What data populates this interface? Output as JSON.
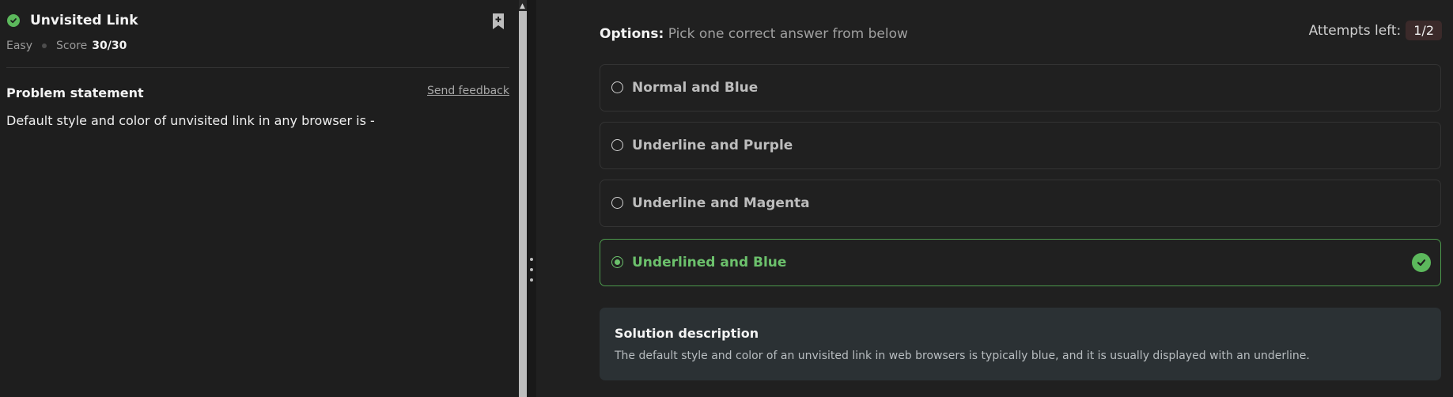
{
  "problem": {
    "title": "Unvisited Link",
    "difficulty": "Easy",
    "score_label": "Score",
    "score_value": "30/30",
    "statement_label": "Problem statement",
    "feedback_link": "Send feedback",
    "statement": "Default style and color of unvisited link in any browser is -"
  },
  "options_panel": {
    "heading_bold": "Options:",
    "heading_rest": "Pick one correct answer from below",
    "attempts_label": "Attempts left:",
    "attempts_value": "1/2",
    "options": [
      {
        "label": "Normal and Blue",
        "selected": false,
        "correct": false
      },
      {
        "label": "Underline and Purple",
        "selected": false,
        "correct": false
      },
      {
        "label": "Underline and Magenta",
        "selected": false,
        "correct": false
      },
      {
        "label": "Underlined and Blue",
        "selected": true,
        "correct": true
      }
    ]
  },
  "solution": {
    "title": "Solution description",
    "text": "The default style and color of an unvisited link in web browsers is typically blue, and it is usually displayed with an underline."
  },
  "icons": {
    "status": "check-circle-icon",
    "bookmark": "bookmark-add-icon",
    "correct": "check-circle-icon",
    "grip": "vertical-dots-icon"
  },
  "colors": {
    "success": "#5cb85c",
    "correct_text": "#6cc16c",
    "background": "#1e1e1e",
    "solution_bg": "#2b3134"
  }
}
